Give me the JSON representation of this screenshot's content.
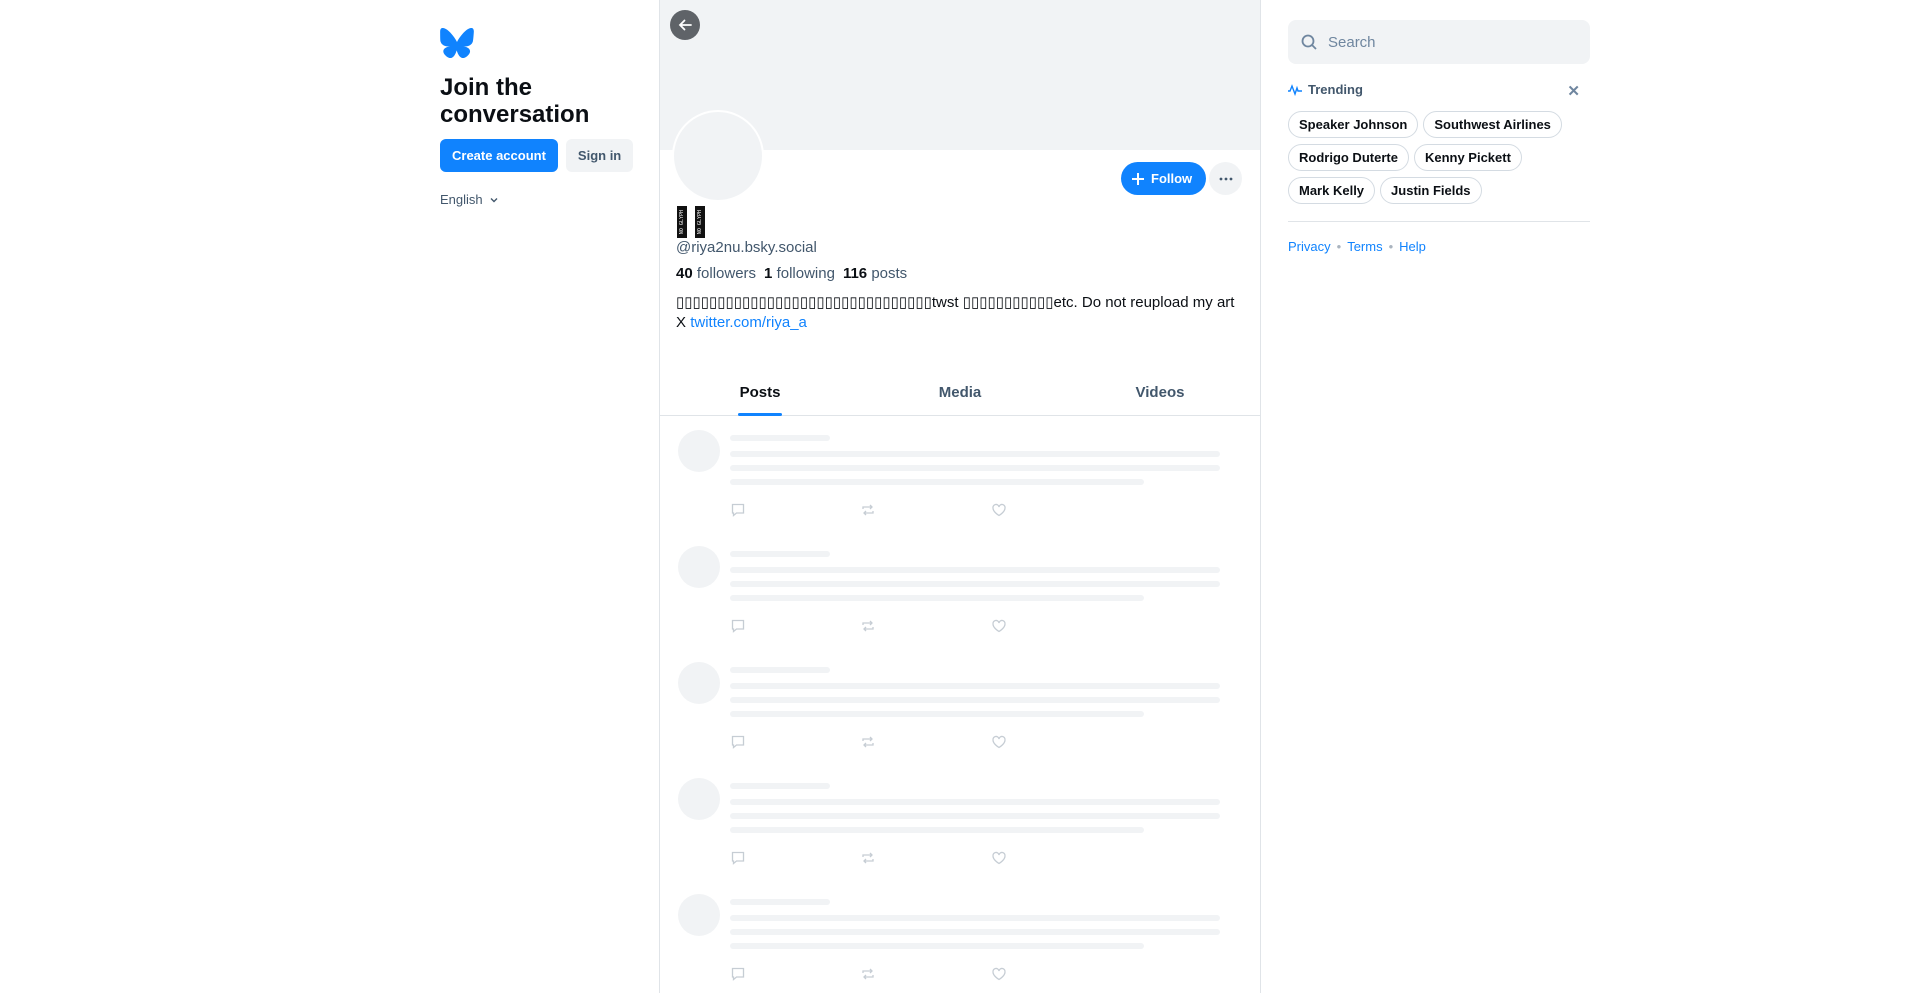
{
  "sidebar": {
    "heading": "Join the conversation",
    "create_account": "Create account",
    "sign_in": "Sign in",
    "language": "English",
    "brand_color": "#1083fe"
  },
  "profile": {
    "name_glyphs": [
      "NO GLYPH",
      "NO GLYPH"
    ],
    "handle": "@riya2nu.bsky.social",
    "followers_count": "40",
    "followers_label": "followers",
    "following_count": "1",
    "following_label": "following",
    "posts_count": "116",
    "posts_label": "posts",
    "bio_line1": "▯▯▯▯▯▯▯▯▯▯▯▯▯▯▯▯▯▯▯▯▯▯▯▯▯▯▯▯▯▯▯twst ▯▯▯▯▯▯▯▯▯▯▯etc. Do not reupload my art",
    "bio_prefix": "X ",
    "bio_link": "twitter.com/riya_a",
    "follow_label": "Follow"
  },
  "tabs": [
    {
      "label": "Posts",
      "active": true
    },
    {
      "label": "Media",
      "active": false
    },
    {
      "label": "Videos",
      "active": false
    }
  ],
  "search": {
    "placeholder": "Search"
  },
  "trending": {
    "title": "Trending",
    "topics": [
      "Speaker Johnson",
      "Southwest Airlines",
      "Rodrigo Duterte",
      "Kenny Pickett",
      "Mark Kelly",
      "Justin Fields"
    ]
  },
  "footer": {
    "privacy": "Privacy",
    "terms": "Terms",
    "help": "Help"
  }
}
